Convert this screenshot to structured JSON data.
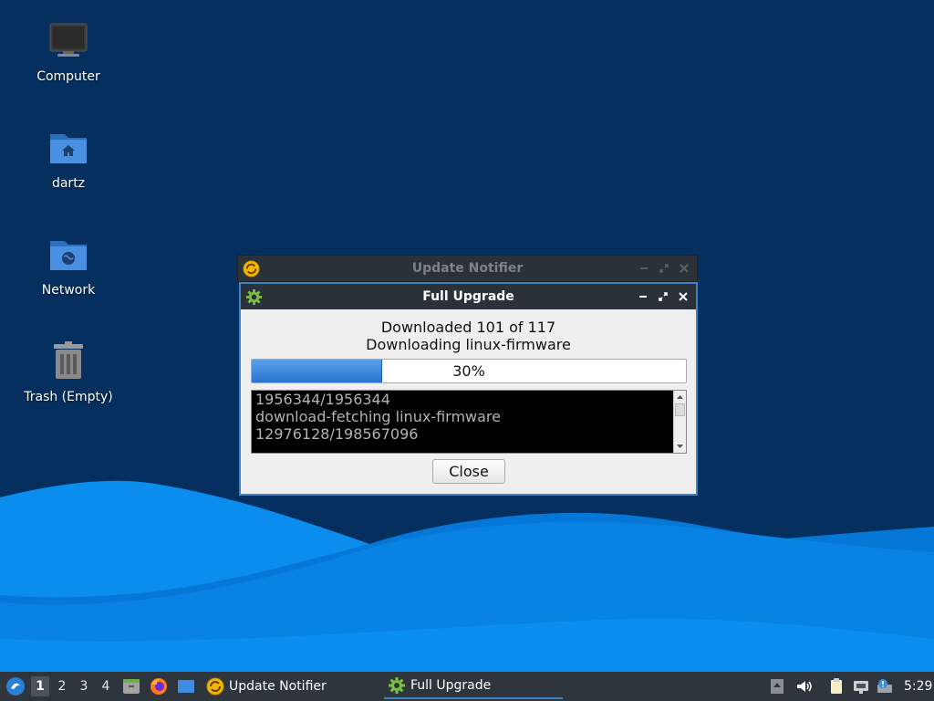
{
  "desktop": {
    "icons": [
      {
        "label": "Computer"
      },
      {
        "label": "dartz"
      },
      {
        "label": "Network"
      },
      {
        "label": "Trash (Empty)"
      }
    ]
  },
  "update_notifier_window": {
    "title": "Update Notifier"
  },
  "full_upgrade_window": {
    "title": "Full Upgrade",
    "status_line1": "Downloaded 101 of 117",
    "status_line2": "Downloading linux-firmware",
    "progress_percent": 30,
    "progress_label": "30%",
    "terminal_lines": [
      "1956344/1956344",
      "download-fetching linux-firmware",
      "12976128/198567096"
    ],
    "close_label": "Close"
  },
  "taskbar": {
    "workspaces": [
      "1",
      "2",
      "3",
      "4"
    ],
    "active_workspace": "1",
    "tasks": [
      {
        "label": "Update Notifier"
      },
      {
        "label": "Full Upgrade"
      }
    ],
    "clock": "5:29"
  },
  "colors": {
    "desktop_background": "#052f5e",
    "wave_light": "#0a86e6",
    "accent": "#3d82c2",
    "titlebar": "#2b3138",
    "taskbar": "#2e353c"
  }
}
